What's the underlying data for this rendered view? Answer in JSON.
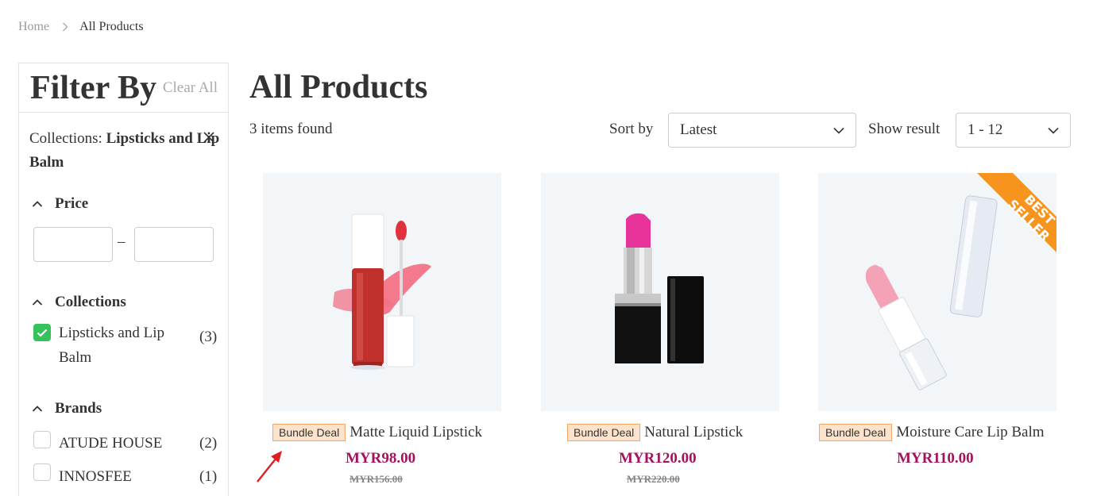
{
  "breadcrumb": {
    "home": "Home",
    "current": "All Products"
  },
  "filter": {
    "title": "Filter By",
    "clear_all": "Clear All",
    "active_prefix": "Collections:",
    "active_value": "Lipsticks and Lip Balm",
    "price": {
      "label": "Price",
      "dash": "–",
      "min_value": "",
      "max_value": ""
    },
    "collections": {
      "label": "Collections",
      "items": [
        {
          "label": "Lipsticks and Lip Balm",
          "count": "(3)",
          "checked": true
        }
      ]
    },
    "brands": {
      "label": "Brands",
      "items": [
        {
          "label": "ATUDE HOUSE",
          "count": "(2)",
          "checked": false
        },
        {
          "label": "INNOSFEE",
          "count": "(1)",
          "checked": false
        }
      ]
    }
  },
  "main": {
    "title": "All Products",
    "items_found": "3 items found",
    "sort_label": "Sort by",
    "sort_value": "Latest",
    "show_label": "Show result",
    "show_value": "1 - 12"
  },
  "products": [
    {
      "badge": "Bundle Deal",
      "name": "Matte Liquid Lipstick",
      "price": "MYR98.00",
      "old_price": "MYR156.00",
      "tag": ""
    },
    {
      "badge": "Bundle Deal",
      "name": "Natural Lipstick",
      "price": "MYR120.00",
      "old_price": "MYR220.00",
      "tag": ""
    },
    {
      "badge": "Bundle Deal",
      "name": "Moisture Care Lip Balm",
      "price": "MYR110.00",
      "old_price": "",
      "tag": "BEST SELLER"
    }
  ],
  "colors": {
    "price": "#a4125b",
    "badge_bg": "#fde3cb",
    "badge_border": "#f5a663",
    "checkbox_checked": "#35c25a",
    "best_seller": "#f7941d",
    "annotation_arrow": "#e02020"
  }
}
